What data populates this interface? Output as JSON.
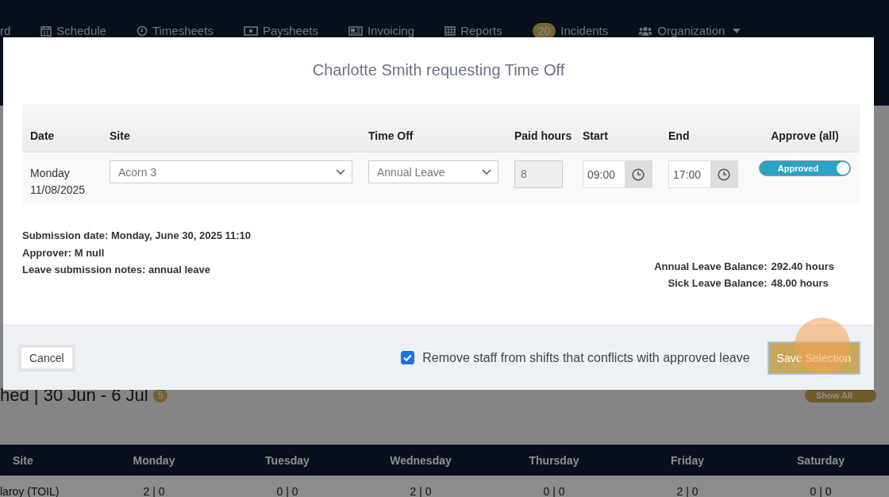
{
  "nav": {
    "items": [
      {
        "label": "rd"
      },
      {
        "label": "Schedule"
      },
      {
        "label": "Timesheets"
      },
      {
        "label": "Paysheets"
      },
      {
        "label": "Invoicing"
      },
      {
        "label": "Reports"
      },
      {
        "label": "Incidents",
        "badge": "20"
      },
      {
        "label": "Organization",
        "dropdown": true
      }
    ]
  },
  "page": {
    "heading": "hed | 30 Jun - 6 Jul",
    "heading_badge": "5",
    "toggle_label": "Show All",
    "table": {
      "columns": [
        "Site",
        "Monday",
        "Tuesday",
        "Wednesday",
        "Thursday",
        "Friday",
        "Saturday"
      ],
      "rows": [
        [
          "laroy (TOIL)",
          "2 | 0",
          "0 | 0",
          "2 | 0",
          "0 | 0",
          "2 | 0",
          "0 | 0"
        ]
      ]
    }
  },
  "modal": {
    "title": "Charlotte Smith requesting Time Off",
    "columns": [
      "Date",
      "Site",
      "Time Off",
      "Paid hours",
      "Start",
      "End",
      "Approve (all)"
    ],
    "rows": [
      {
        "date": "Monday",
        "date2": "11/08/2025",
        "site": "Acorn 3",
        "time_off": "Annual Leave",
        "paid_hours": "8",
        "start": "09:00",
        "end": "17:00",
        "approve_label": "Approved",
        "approved": true
      }
    ],
    "details": [
      "Submission date: Monday, June 30, 2025 11:10",
      "Approver: M null",
      "Leave submission notes: annual leave"
    ],
    "balances": [
      {
        "label": "Annual Leave Balance:",
        "value": "292.40 hours"
      },
      {
        "label": "Sick Leave Balance:",
        "value": "48.00 hours"
      }
    ],
    "cancel": "Cancel",
    "remove_staff": {
      "label": "Remove staff from shifts that conflicts with approved leave",
      "checked": true
    },
    "save": "Save Selection",
    "click_highlight": true
  }
}
